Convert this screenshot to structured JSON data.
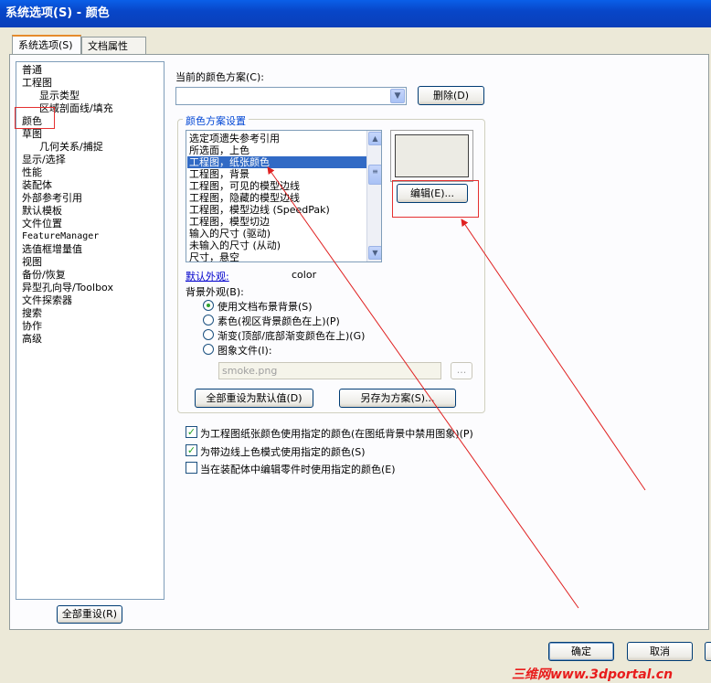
{
  "window": {
    "title": "系统选项(S) - 颜色"
  },
  "tabs": [
    {
      "label": "系统选项(S)"
    },
    {
      "label": "文档属性(D)"
    }
  ],
  "tree": {
    "items": [
      {
        "label": "普通"
      },
      {
        "label": "工程图"
      },
      {
        "label": "显示类型"
      },
      {
        "label": "区域剖面线/填充"
      },
      {
        "label": "颜色"
      },
      {
        "label": "草图"
      },
      {
        "label": "几何关系/捕捉"
      },
      {
        "label": "显示/选择"
      },
      {
        "label": "性能"
      },
      {
        "label": "装配体"
      },
      {
        "label": "外部参考引用"
      },
      {
        "label": "默认模板"
      },
      {
        "label": "文件位置"
      },
      {
        "label": "FeatureManager"
      },
      {
        "label": "选值框增量值"
      },
      {
        "label": "视图"
      },
      {
        "label": "备份/恢复"
      },
      {
        "label": "异型孔向导/Toolbox"
      },
      {
        "label": "文件探索器"
      },
      {
        "label": "搜索"
      },
      {
        "label": "协作"
      },
      {
        "label": "高级"
      }
    ],
    "reset_label": "全部重设(R)"
  },
  "scheme": {
    "label": "当前的颜色方案(C):",
    "value": "",
    "delete_label": "删除(D)"
  },
  "settings": {
    "group_label": "颜色方案设置",
    "items": [
      {
        "label": "选定项遗失参考引用"
      },
      {
        "label": "所选面，上色"
      },
      {
        "label": "工程图，纸张颜色"
      },
      {
        "label": "工程图，背景"
      },
      {
        "label": "工程图，可见的模型边线"
      },
      {
        "label": "工程图，隐藏的模型边线"
      },
      {
        "label": "工程图，模型边线 (SpeedPak)"
      },
      {
        "label": "工程图，模型切边"
      },
      {
        "label": "输入的尺寸 (驱动)"
      },
      {
        "label": "未输入的尺寸 (从动)"
      },
      {
        "label": "尺寸，悬空"
      }
    ],
    "selected_index": 2,
    "edit_label": "编辑(E)...",
    "swatch_color": "#ecebe4",
    "default_appearance_label": "默认外观:",
    "default_appearance_value": "color",
    "bg_label": "背景外观(B):",
    "bg_options": [
      {
        "label": "使用文档布景背景(S)",
        "checked": true
      },
      {
        "label": "素色(视区背景颜色在上)(P)",
        "checked": false
      },
      {
        "label": "渐变(顶部/底部渐变颜色在上)(G)",
        "checked": false
      },
      {
        "label": "图象文件(I):",
        "checked": false
      }
    ],
    "image_file": "smoke.png",
    "browse_label": "...",
    "reset_default_label": "全部重设为默认值(D)",
    "save_scheme_label": "另存为方案(S)..."
  },
  "checkboxes": [
    {
      "label": "为工程图纸张颜色使用指定的颜色(在图纸背景中禁用图象)(P)",
      "checked": true
    },
    {
      "label": "为带边线上色模式使用指定的颜色(S)",
      "checked": true
    },
    {
      "label": "当在装配体中编辑零件时使用指定的颜色(E)",
      "checked": false
    }
  ],
  "footer": {
    "ok_label": "确定",
    "cancel_label": "取消"
  },
  "watermark": "三维网www.3dportal.cn"
}
